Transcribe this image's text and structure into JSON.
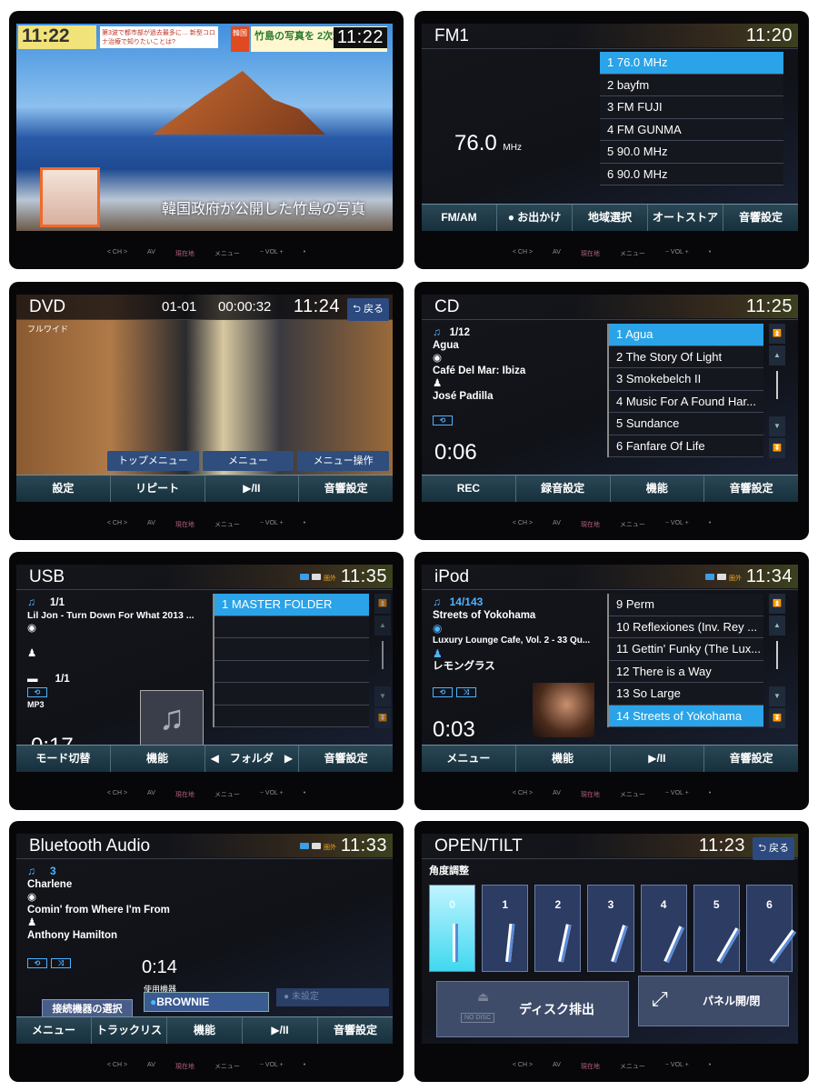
{
  "hardware": {
    "ch": "< CH >",
    "av": "AV",
    "location": "現在地",
    "menu": "メニュー",
    "vol": "− VOL +",
    "dot": "•"
  },
  "tv": {
    "clock": "11:22",
    "ticker_time": "11:22",
    "ticker_left": "第3波で都市部が過去最多に… 新型コロナ治療で知りたいことは?",
    "ticker_right_tag": "韓国",
    "ticker_right": "竹島の写真を 2次利用可能…",
    "caption": "韓国政府が公開した竹島の写真"
  },
  "fm": {
    "title": "FM1",
    "clock": "11:20",
    "frequency": "76.0",
    "unit": "MHz",
    "presets": [
      "1 76.0 MHz",
      "2 bayfm",
      "3 FM FUJI",
      "4 FM GUNMA",
      "5 90.0 MHz",
      "6 90.0 MHz"
    ],
    "selected": 0,
    "buttons": [
      "FM/AM",
      "● お出かけ",
      "地域選択",
      "オートストア",
      "音響設定"
    ]
  },
  "dvd": {
    "title": "DVD",
    "chapter": "01-01",
    "elapsed": "00:00:32",
    "clock": "11:24",
    "back": "⮌ 戻る",
    "aspect": "フルワイド",
    "menu_buttons": [
      "トップメニュー",
      "メニュー",
      "メニュー操作"
    ],
    "buttons": [
      "設定",
      "リピート",
      "▶/II",
      "音響設定"
    ]
  },
  "cd": {
    "title": "CD",
    "clock": "11:25",
    "track_no": "1/12",
    "track": "Agua",
    "album": "Café Del Mar: Ibiza",
    "artist": "José Padilla",
    "time": "0:06",
    "tracks": [
      "1 Agua",
      "2 The Story Of Light",
      "3 Smokebelch II",
      "4 Music For A Found Har...",
      "5 Sundance",
      "6 Fanfare Of Life"
    ],
    "selected": 0,
    "buttons": [
      "REC",
      "録音設定",
      "機能",
      "音響設定"
    ]
  },
  "usb": {
    "title": "USB",
    "clock": "11:35",
    "status_text": "圏外",
    "track_no": "1/1",
    "track": "Lil Jon - Turn Down For What 2013 ...",
    "folder_no": "1/1",
    "format": "MP3",
    "time": "0:17",
    "folders": [
      "1 MASTER FOLDER",
      "",
      "",
      "",
      "",
      ""
    ],
    "selected": 0,
    "buttons": [
      "モード切替",
      "機能",
      "◀　フォルダ　▶",
      "音響設定"
    ]
  },
  "ipod": {
    "title": "iPod",
    "clock": "11:34",
    "status_text": "圏外",
    "track_no": "14/143",
    "track": "Streets of Yokohama",
    "album": "Luxury Lounge Cafe, Vol. 2 - 33 Qu...",
    "artist": "レモングラス",
    "time": "0:03",
    "tracks": [
      "9 Perm",
      "10 Reflexiones (Inv. Rey ...",
      "11 Gettin' Funky (The Lux...",
      "12 There is a Way",
      "13 So Large",
      "14 Streets of Yokohama"
    ],
    "selected": 5,
    "buttons": [
      "メニュー",
      "機能",
      "▶/II",
      "音響設定"
    ]
  },
  "bt": {
    "title": "Bluetooth Audio",
    "clock": "11:33",
    "status_text": "圏外",
    "track_no": "3",
    "track": "Charlene",
    "album": "Comin' from Where I'm From",
    "artist": "Anthony Hamilton",
    "time": "0:14",
    "device_label": "使用機器",
    "select_device": "接続機器の選択",
    "device": "BROWNIE",
    "device2": "未設定",
    "buttons": [
      "メニュー",
      "トラックリスト",
      "機能",
      "▶/II",
      "音響設定"
    ]
  },
  "tilt": {
    "title": "OPEN/TILT",
    "clock": "11:23",
    "back": "⮌ 戻る",
    "section": "角度調整",
    "angles": [
      "0",
      "1",
      "2",
      "3",
      "4",
      "5",
      "6"
    ],
    "selected": 0,
    "eject": "ディスク排出",
    "no_disc": "NO DISC",
    "panel": "パネル開/閉"
  },
  "colors": {
    "accent": "#2aa3e8",
    "bar": "#2b4755"
  }
}
